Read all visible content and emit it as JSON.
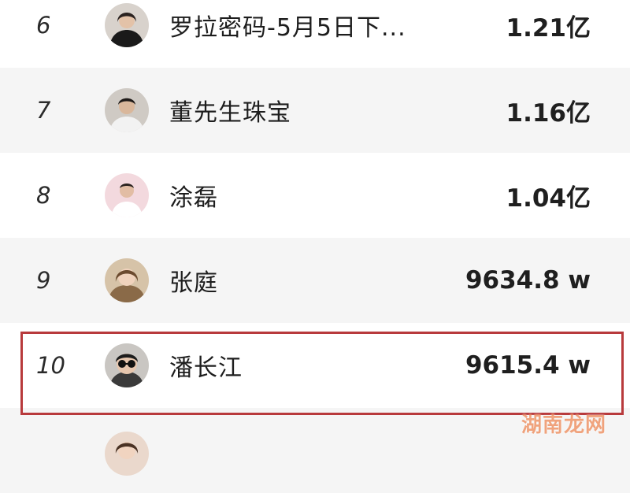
{
  "ranking": [
    {
      "rank": "6",
      "name": "罗拉密码-5月5日下...",
      "value": "1.21亿"
    },
    {
      "rank": "7",
      "name": "董先生珠宝",
      "value": "1.16亿"
    },
    {
      "rank": "8",
      "name": "涂磊",
      "value": "1.04亿"
    },
    {
      "rank": "9",
      "name": "张庭",
      "value": "9634.8 w"
    },
    {
      "rank": "10",
      "name": "潘长江",
      "value": "9615.4 w"
    },
    {
      "rank": "",
      "name": "",
      "value": ""
    }
  ],
  "watermark": "湖南龙网",
  "colors": {
    "highlight_border": "#b83a3c",
    "row_alt_bg": "#f5f5f5",
    "watermark": "#e65a14"
  }
}
